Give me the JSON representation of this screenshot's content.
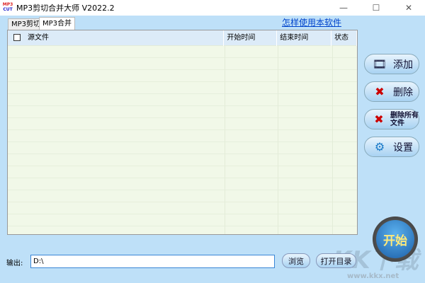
{
  "window": {
    "title": "MP3剪切合并大师 V2022.2",
    "logo_text": [
      "MP3",
      "CUT"
    ],
    "minimize": "—",
    "maximize": "☐",
    "close": "✕"
  },
  "tabs": [
    {
      "label": "MP3剪切"
    },
    {
      "label": "MP3合并",
      "active": true
    }
  ],
  "help_link": "怎样使用本软件",
  "table": {
    "columns": [
      "源文件",
      "开始时间",
      "结束时间",
      "状态"
    ],
    "rows": []
  },
  "side_buttons": {
    "add": "添加",
    "delete": "删除",
    "delete_all": "删除所有文件",
    "settings": "设置"
  },
  "start_button": "开始",
  "output": {
    "label": "输出:",
    "value": "D:\\",
    "browse": "浏览",
    "open_dir": "打开目录"
  },
  "watermark": {
    "logo": "KK下载",
    "url": "www.kkx.net"
  }
}
